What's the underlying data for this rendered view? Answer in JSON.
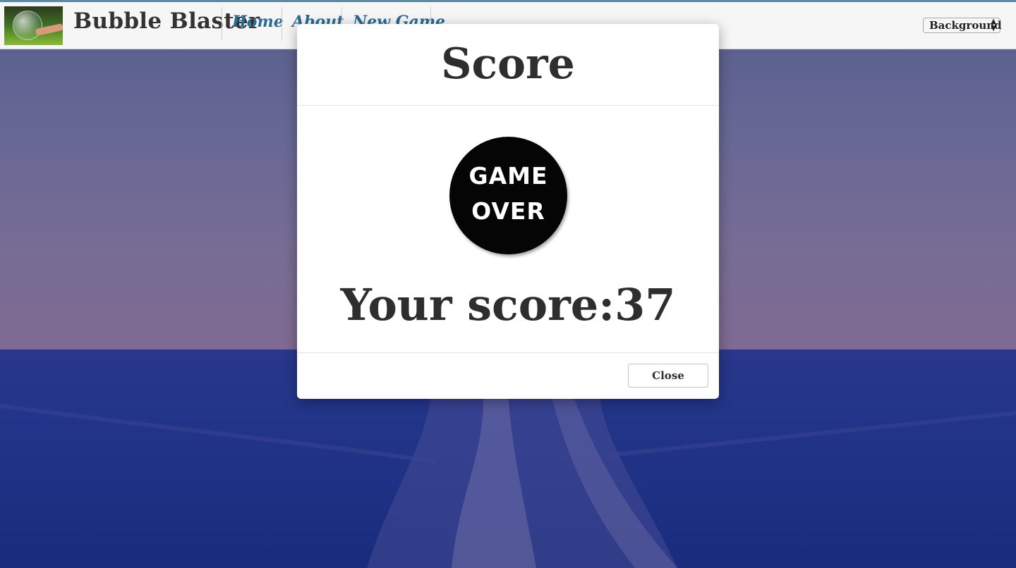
{
  "app": {
    "brand_title": "Bubble Blaster"
  },
  "nav": {
    "links": [
      {
        "label": "Home"
      },
      {
        "label": "About"
      },
      {
        "label": "New Game"
      }
    ],
    "background_select": {
      "selected": "Background",
      "arrows": "▲▼"
    }
  },
  "modal": {
    "title": "Score",
    "badge": {
      "line1": "GAME",
      "line2": "OVER"
    },
    "score_label": "Your score:",
    "score_value": "37",
    "close_label": "Close"
  },
  "colors": {
    "nav_link": "#2a6a93",
    "text": "#2e2e2e",
    "badge_bg": "#050505"
  }
}
